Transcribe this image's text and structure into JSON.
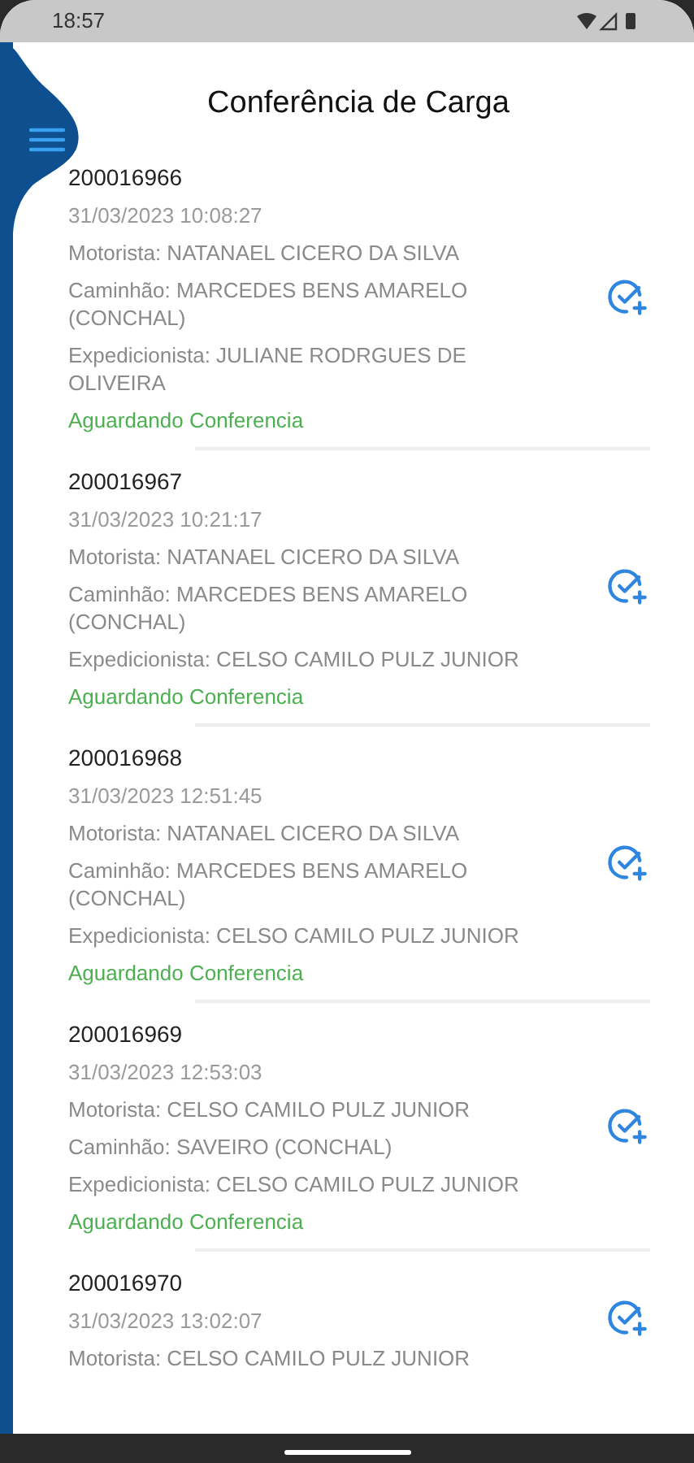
{
  "status_bar": {
    "time": "18:57"
  },
  "title": "Conferência de Carga",
  "loads": [
    {
      "id": "200016966",
      "date": "31/03/2023 10:08:27",
      "details": [
        "Motorista: NATANAEL CICERO DA SILVA",
        "Caminhão: MARCEDES BENS AMARELO (CONCHAL)",
        "Expedicionista: JULIANE RODRGUES DE OLIVEIRA"
      ],
      "status": "Aguardando Conferencia"
    },
    {
      "id": "200016967",
      "date": "31/03/2023 10:21:17",
      "details": [
        "Motorista: NATANAEL CICERO DA SILVA",
        "Caminhão: MARCEDES BENS AMARELO (CONCHAL)",
        "Expedicionista: CELSO CAMILO PULZ JUNIOR"
      ],
      "status": "Aguardando Conferencia"
    },
    {
      "id": "200016968",
      "date": "31/03/2023 12:51:45",
      "details": [
        "Motorista: NATANAEL CICERO DA SILVA",
        "Caminhão: MARCEDES BENS AMARELO (CONCHAL)",
        "Expedicionista: CELSO CAMILO PULZ JUNIOR"
      ],
      "status": "Aguardando Conferencia"
    },
    {
      "id": "200016969",
      "date": "31/03/2023 12:53:03",
      "details": [
        "Motorista: CELSO CAMILO PULZ JUNIOR",
        "Caminhão: SAVEIRO (CONCHAL)",
        "Expedicionista: CELSO CAMILO PULZ JUNIOR"
      ],
      "status": "Aguardando Conferencia"
    },
    {
      "id": "200016970",
      "date": "31/03/2023 13:02:07",
      "details": [
        "Motorista: CELSO CAMILO PULZ JUNIOR"
      ]
    }
  ]
}
